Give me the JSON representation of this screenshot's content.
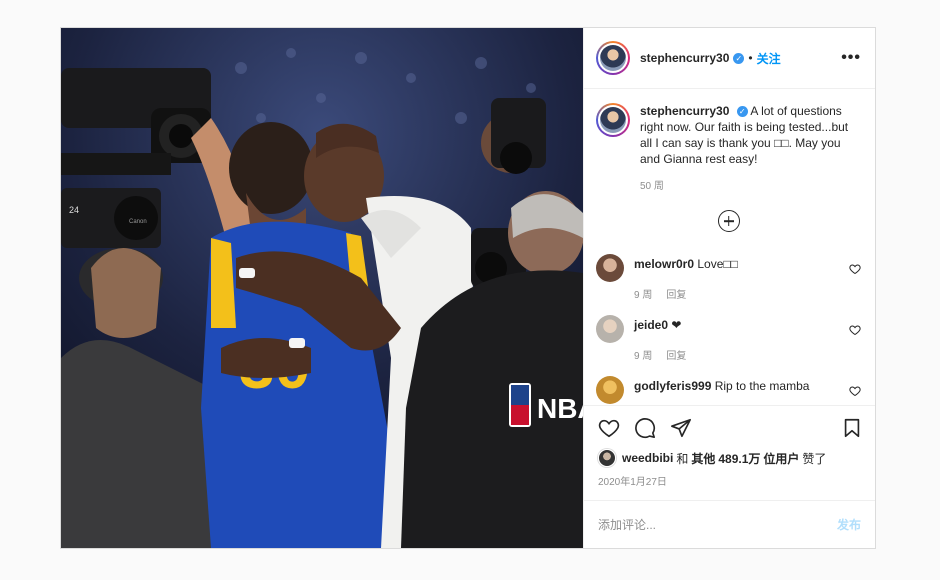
{
  "post": {
    "username": "stephencurry30",
    "follow_label": "关注",
    "separator": "•",
    "more_label": "•••",
    "caption": {
      "username": "stephencurry30",
      "text": "A lot of questions right now. Our faith is being tested...but all I can say is thank you □□. May you and Gianna rest easy!",
      "age": "50 周"
    },
    "comments": [
      {
        "username": "melowr0r0",
        "text": "Love□□",
        "age": "9 周",
        "reply": "回复",
        "avatar_color": "#6b4a3a"
      },
      {
        "username": "jeide0",
        "text": "❤",
        "age": "9 周",
        "reply": "回复",
        "avatar_color": "#b7b2ab"
      },
      {
        "username": "godlyferis999",
        "text": "Rip to the mamba",
        "age": "",
        "reply": "",
        "avatar_color": "#c28a2e"
      }
    ],
    "likes": {
      "user": "weedbibi",
      "joiner": "和",
      "others": "其他",
      "count": "489.1万",
      "unit": "位用户",
      "suffix": "赞了"
    },
    "date": "2020年1月27日",
    "add_comment": {
      "placeholder": "添加评论...",
      "post_label": "发布"
    },
    "photo": {
      "jersey_number": "30",
      "camera_label": "24",
      "nba_text": "NBA",
      "camera_brand": "Canon"
    }
  },
  "colors": {
    "link": "#0095f6",
    "verified": "#3897f0",
    "muted": "#8e8e8e"
  }
}
